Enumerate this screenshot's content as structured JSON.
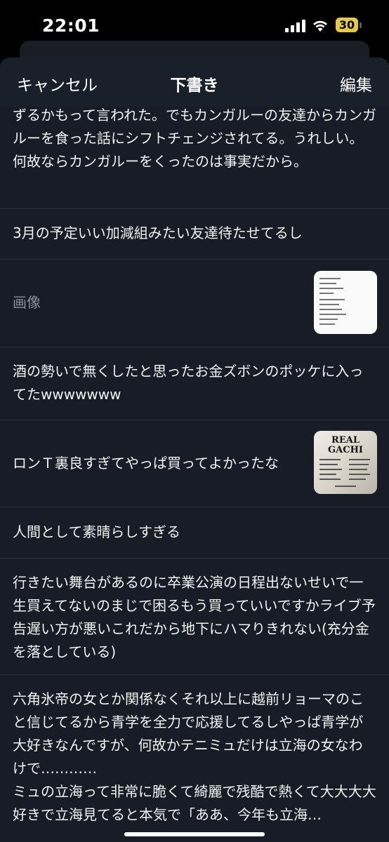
{
  "status_bar": {
    "time": "22:01",
    "battery": "30"
  },
  "nav": {
    "cancel": "キャンセル",
    "title": "下書き",
    "edit": "編集"
  },
  "drafts": [
    {
      "text": "ずるかもって言われた。でもカンガルーの友達からカンガルーを食った話にシフトチェンジされてる。うれしい。何故ならカンガルーをくったのは事実だから。"
    },
    {
      "text": "3月の予定いい加減組みたい友達待たせてるし"
    },
    {
      "text": "画像",
      "thumbnail": "document-image"
    },
    {
      "text": "酒の勢いで無くしたと思ったお金ズボンのポッケに入ってたwwwwwww"
    },
    {
      "text": "ロンＴ裏良すぎてやっぱ買ってよかったな",
      "thumbnail": "shirt-print-image",
      "thumbnail_text": [
        "REAL",
        "GACHI"
      ]
    },
    {
      "text": "人間として素晴らしすぎる"
    },
    {
      "text": "行きたい舞台があるのに卒業公演の日程出ないせいで一生買えてないのまじで困るもう買っていいですかライブ予告遅い方が悪いこれだから地下にハマりきれない(充分金を落としている)"
    },
    {
      "text": "六角氷帝の女とか関係なくそれ以上に越前リョーマのこと信じてるから青学を全力で応援してるしやっぱ青学が大好きなんですが、何故かテニミュだけは立海の女なわけで…………",
      "text2": "ミュの立海って非常に脆くて綺麗で残酷で熱くて大大大大好きで立海見てると本気で「ああ、今年も立海…"
    }
  ],
  "colors": {
    "sheet": "#171c26",
    "nav": "#1a2029",
    "divider": "#2a313c",
    "battery": "#e3c84a",
    "muted_text": "#8a8f98"
  }
}
